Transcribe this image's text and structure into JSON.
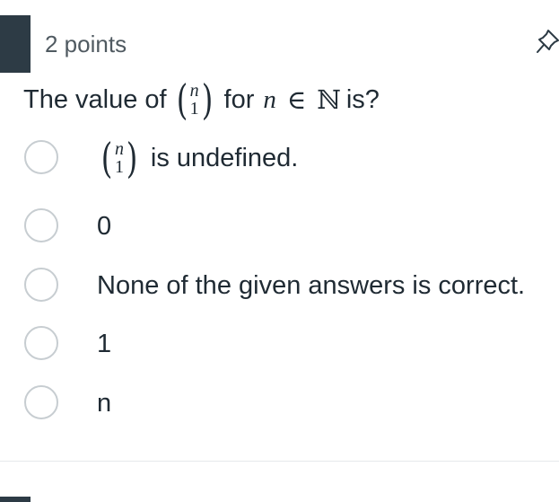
{
  "question_card": {
    "points_label": "2 points",
    "icons": {
      "pin": "pin-icon"
    },
    "question": {
      "prefix": "The value of",
      "binom_top": "n",
      "binom_bottom": "1",
      "for_text": "for",
      "variable": "n",
      "element_of": "∈",
      "set": "ℕ",
      "suffix": "is?"
    },
    "answers": [
      {
        "binom_top": "n",
        "binom_bottom": "1",
        "label": "is undefined."
      },
      {
        "label": "0"
      },
      {
        "label": "None of the given answers is correct."
      },
      {
        "label": "1"
      },
      {
        "label": "n"
      }
    ]
  },
  "colors": {
    "accent": "#2d3b45",
    "text": "#1f2a33",
    "muted_text": "#505a61",
    "radio_border": "#c7cdd1",
    "divider": "#e6e9eb"
  }
}
